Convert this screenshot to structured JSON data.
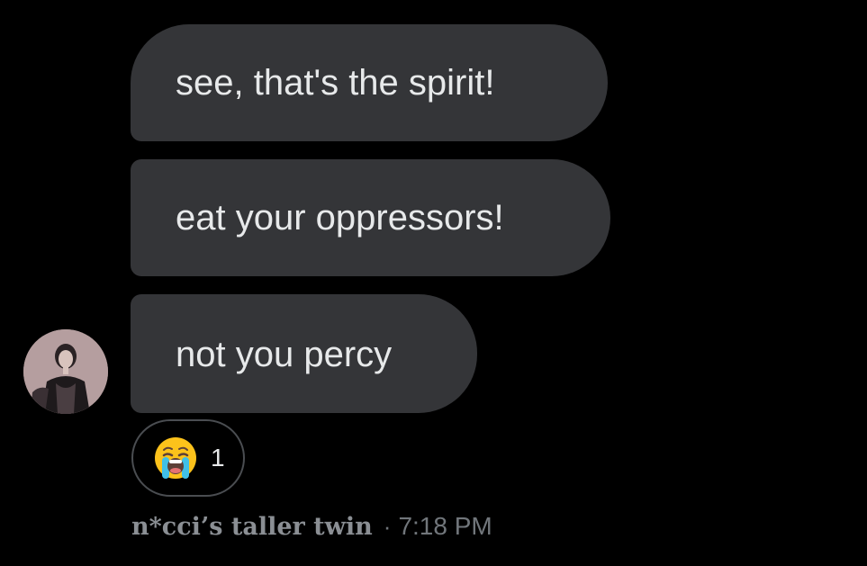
{
  "messages": [
    {
      "text": "see, that's the spirit!"
    },
    {
      "text": "eat your oppressors!"
    },
    {
      "text": "not you percy"
    }
  ],
  "reaction": {
    "emoji": "loudly-crying-face",
    "count": "1"
  },
  "footer": {
    "sender": "n*cci’s taller twin",
    "separator": "·",
    "time": "7:18 PM"
  },
  "colors": {
    "background": "#000000",
    "bubble": "#343538",
    "text": "#e7e9ea",
    "muted": "#71767b"
  }
}
